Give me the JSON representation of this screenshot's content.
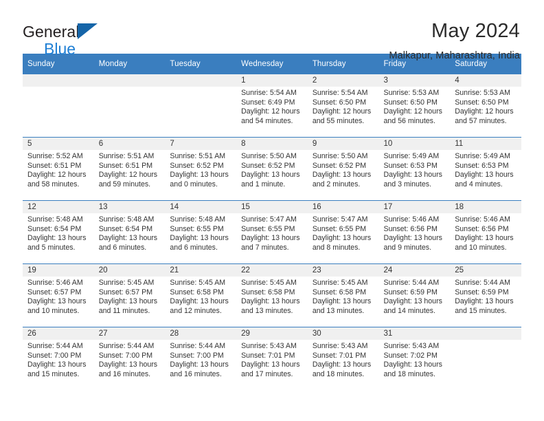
{
  "brand": {
    "name_part1": "General",
    "name_part2": "Blue",
    "accent_color": "#1f7fd4",
    "triangle_color": "#1565a8"
  },
  "header": {
    "title": "May 2024",
    "subtitle": "Malkapur, Maharashtra, India"
  },
  "theme": {
    "header_row_bg": "#3a7ebf",
    "header_row_text": "#ffffff",
    "daynum_band_bg": "#f0f0f0",
    "grid_line": "#3a7ebf"
  },
  "weekday_headers": [
    "Sunday",
    "Monday",
    "Tuesday",
    "Wednesday",
    "Thursday",
    "Friday",
    "Saturday"
  ],
  "weeks": [
    [
      {
        "day": "",
        "empty": true,
        "sunrise": "",
        "sunset": "",
        "daylight_line1": "",
        "daylight_line2": ""
      },
      {
        "day": "",
        "empty": true,
        "sunrise": "",
        "sunset": "",
        "daylight_line1": "",
        "daylight_line2": ""
      },
      {
        "day": "",
        "empty": true,
        "sunrise": "",
        "sunset": "",
        "daylight_line1": "",
        "daylight_line2": ""
      },
      {
        "day": "1",
        "empty": false,
        "sunrise": "Sunrise: 5:54 AM",
        "sunset": "Sunset: 6:49 PM",
        "daylight_line1": "Daylight: 12 hours",
        "daylight_line2": "and 54 minutes."
      },
      {
        "day": "2",
        "empty": false,
        "sunrise": "Sunrise: 5:54 AM",
        "sunset": "Sunset: 6:50 PM",
        "daylight_line1": "Daylight: 12 hours",
        "daylight_line2": "and 55 minutes."
      },
      {
        "day": "3",
        "empty": false,
        "sunrise": "Sunrise: 5:53 AM",
        "sunset": "Sunset: 6:50 PM",
        "daylight_line1": "Daylight: 12 hours",
        "daylight_line2": "and 56 minutes."
      },
      {
        "day": "4",
        "empty": false,
        "sunrise": "Sunrise: 5:53 AM",
        "sunset": "Sunset: 6:50 PM",
        "daylight_line1": "Daylight: 12 hours",
        "daylight_line2": "and 57 minutes."
      }
    ],
    [
      {
        "day": "5",
        "empty": false,
        "sunrise": "Sunrise: 5:52 AM",
        "sunset": "Sunset: 6:51 PM",
        "daylight_line1": "Daylight: 12 hours",
        "daylight_line2": "and 58 minutes."
      },
      {
        "day": "6",
        "empty": false,
        "sunrise": "Sunrise: 5:51 AM",
        "sunset": "Sunset: 6:51 PM",
        "daylight_line1": "Daylight: 12 hours",
        "daylight_line2": "and 59 minutes."
      },
      {
        "day": "7",
        "empty": false,
        "sunrise": "Sunrise: 5:51 AM",
        "sunset": "Sunset: 6:52 PM",
        "daylight_line1": "Daylight: 13 hours",
        "daylight_line2": "and 0 minutes."
      },
      {
        "day": "8",
        "empty": false,
        "sunrise": "Sunrise: 5:50 AM",
        "sunset": "Sunset: 6:52 PM",
        "daylight_line1": "Daylight: 13 hours",
        "daylight_line2": "and 1 minute."
      },
      {
        "day": "9",
        "empty": false,
        "sunrise": "Sunrise: 5:50 AM",
        "sunset": "Sunset: 6:52 PM",
        "daylight_line1": "Daylight: 13 hours",
        "daylight_line2": "and 2 minutes."
      },
      {
        "day": "10",
        "empty": false,
        "sunrise": "Sunrise: 5:49 AM",
        "sunset": "Sunset: 6:53 PM",
        "daylight_line1": "Daylight: 13 hours",
        "daylight_line2": "and 3 minutes."
      },
      {
        "day": "11",
        "empty": false,
        "sunrise": "Sunrise: 5:49 AM",
        "sunset": "Sunset: 6:53 PM",
        "daylight_line1": "Daylight: 13 hours",
        "daylight_line2": "and 4 minutes."
      }
    ],
    [
      {
        "day": "12",
        "empty": false,
        "sunrise": "Sunrise: 5:48 AM",
        "sunset": "Sunset: 6:54 PM",
        "daylight_line1": "Daylight: 13 hours",
        "daylight_line2": "and 5 minutes."
      },
      {
        "day": "13",
        "empty": false,
        "sunrise": "Sunrise: 5:48 AM",
        "sunset": "Sunset: 6:54 PM",
        "daylight_line1": "Daylight: 13 hours",
        "daylight_line2": "and 6 minutes."
      },
      {
        "day": "14",
        "empty": false,
        "sunrise": "Sunrise: 5:48 AM",
        "sunset": "Sunset: 6:55 PM",
        "daylight_line1": "Daylight: 13 hours",
        "daylight_line2": "and 6 minutes."
      },
      {
        "day": "15",
        "empty": false,
        "sunrise": "Sunrise: 5:47 AM",
        "sunset": "Sunset: 6:55 PM",
        "daylight_line1": "Daylight: 13 hours",
        "daylight_line2": "and 7 minutes."
      },
      {
        "day": "16",
        "empty": false,
        "sunrise": "Sunrise: 5:47 AM",
        "sunset": "Sunset: 6:55 PM",
        "daylight_line1": "Daylight: 13 hours",
        "daylight_line2": "and 8 minutes."
      },
      {
        "day": "17",
        "empty": false,
        "sunrise": "Sunrise: 5:46 AM",
        "sunset": "Sunset: 6:56 PM",
        "daylight_line1": "Daylight: 13 hours",
        "daylight_line2": "and 9 minutes."
      },
      {
        "day": "18",
        "empty": false,
        "sunrise": "Sunrise: 5:46 AM",
        "sunset": "Sunset: 6:56 PM",
        "daylight_line1": "Daylight: 13 hours",
        "daylight_line2": "and 10 minutes."
      }
    ],
    [
      {
        "day": "19",
        "empty": false,
        "sunrise": "Sunrise: 5:46 AM",
        "sunset": "Sunset: 6:57 PM",
        "daylight_line1": "Daylight: 13 hours",
        "daylight_line2": "and 10 minutes."
      },
      {
        "day": "20",
        "empty": false,
        "sunrise": "Sunrise: 5:45 AM",
        "sunset": "Sunset: 6:57 PM",
        "daylight_line1": "Daylight: 13 hours",
        "daylight_line2": "and 11 minutes."
      },
      {
        "day": "21",
        "empty": false,
        "sunrise": "Sunrise: 5:45 AM",
        "sunset": "Sunset: 6:58 PM",
        "daylight_line1": "Daylight: 13 hours",
        "daylight_line2": "and 12 minutes."
      },
      {
        "day": "22",
        "empty": false,
        "sunrise": "Sunrise: 5:45 AM",
        "sunset": "Sunset: 6:58 PM",
        "daylight_line1": "Daylight: 13 hours",
        "daylight_line2": "and 13 minutes."
      },
      {
        "day": "23",
        "empty": false,
        "sunrise": "Sunrise: 5:45 AM",
        "sunset": "Sunset: 6:58 PM",
        "daylight_line1": "Daylight: 13 hours",
        "daylight_line2": "and 13 minutes."
      },
      {
        "day": "24",
        "empty": false,
        "sunrise": "Sunrise: 5:44 AM",
        "sunset": "Sunset: 6:59 PM",
        "daylight_line1": "Daylight: 13 hours",
        "daylight_line2": "and 14 minutes."
      },
      {
        "day": "25",
        "empty": false,
        "sunrise": "Sunrise: 5:44 AM",
        "sunset": "Sunset: 6:59 PM",
        "daylight_line1": "Daylight: 13 hours",
        "daylight_line2": "and 15 minutes."
      }
    ],
    [
      {
        "day": "26",
        "empty": false,
        "sunrise": "Sunrise: 5:44 AM",
        "sunset": "Sunset: 7:00 PM",
        "daylight_line1": "Daylight: 13 hours",
        "daylight_line2": "and 15 minutes."
      },
      {
        "day": "27",
        "empty": false,
        "sunrise": "Sunrise: 5:44 AM",
        "sunset": "Sunset: 7:00 PM",
        "daylight_line1": "Daylight: 13 hours",
        "daylight_line2": "and 16 minutes."
      },
      {
        "day": "28",
        "empty": false,
        "sunrise": "Sunrise: 5:44 AM",
        "sunset": "Sunset: 7:00 PM",
        "daylight_line1": "Daylight: 13 hours",
        "daylight_line2": "and 16 minutes."
      },
      {
        "day": "29",
        "empty": false,
        "sunrise": "Sunrise: 5:43 AM",
        "sunset": "Sunset: 7:01 PM",
        "daylight_line1": "Daylight: 13 hours",
        "daylight_line2": "and 17 minutes."
      },
      {
        "day": "30",
        "empty": false,
        "sunrise": "Sunrise: 5:43 AM",
        "sunset": "Sunset: 7:01 PM",
        "daylight_line1": "Daylight: 13 hours",
        "daylight_line2": "and 18 minutes."
      },
      {
        "day": "31",
        "empty": false,
        "sunrise": "Sunrise: 5:43 AM",
        "sunset": "Sunset: 7:02 PM",
        "daylight_line1": "Daylight: 13 hours",
        "daylight_line2": "and 18 minutes."
      },
      {
        "day": "",
        "empty": true,
        "sunrise": "",
        "sunset": "",
        "daylight_line1": "",
        "daylight_line2": ""
      }
    ]
  ]
}
